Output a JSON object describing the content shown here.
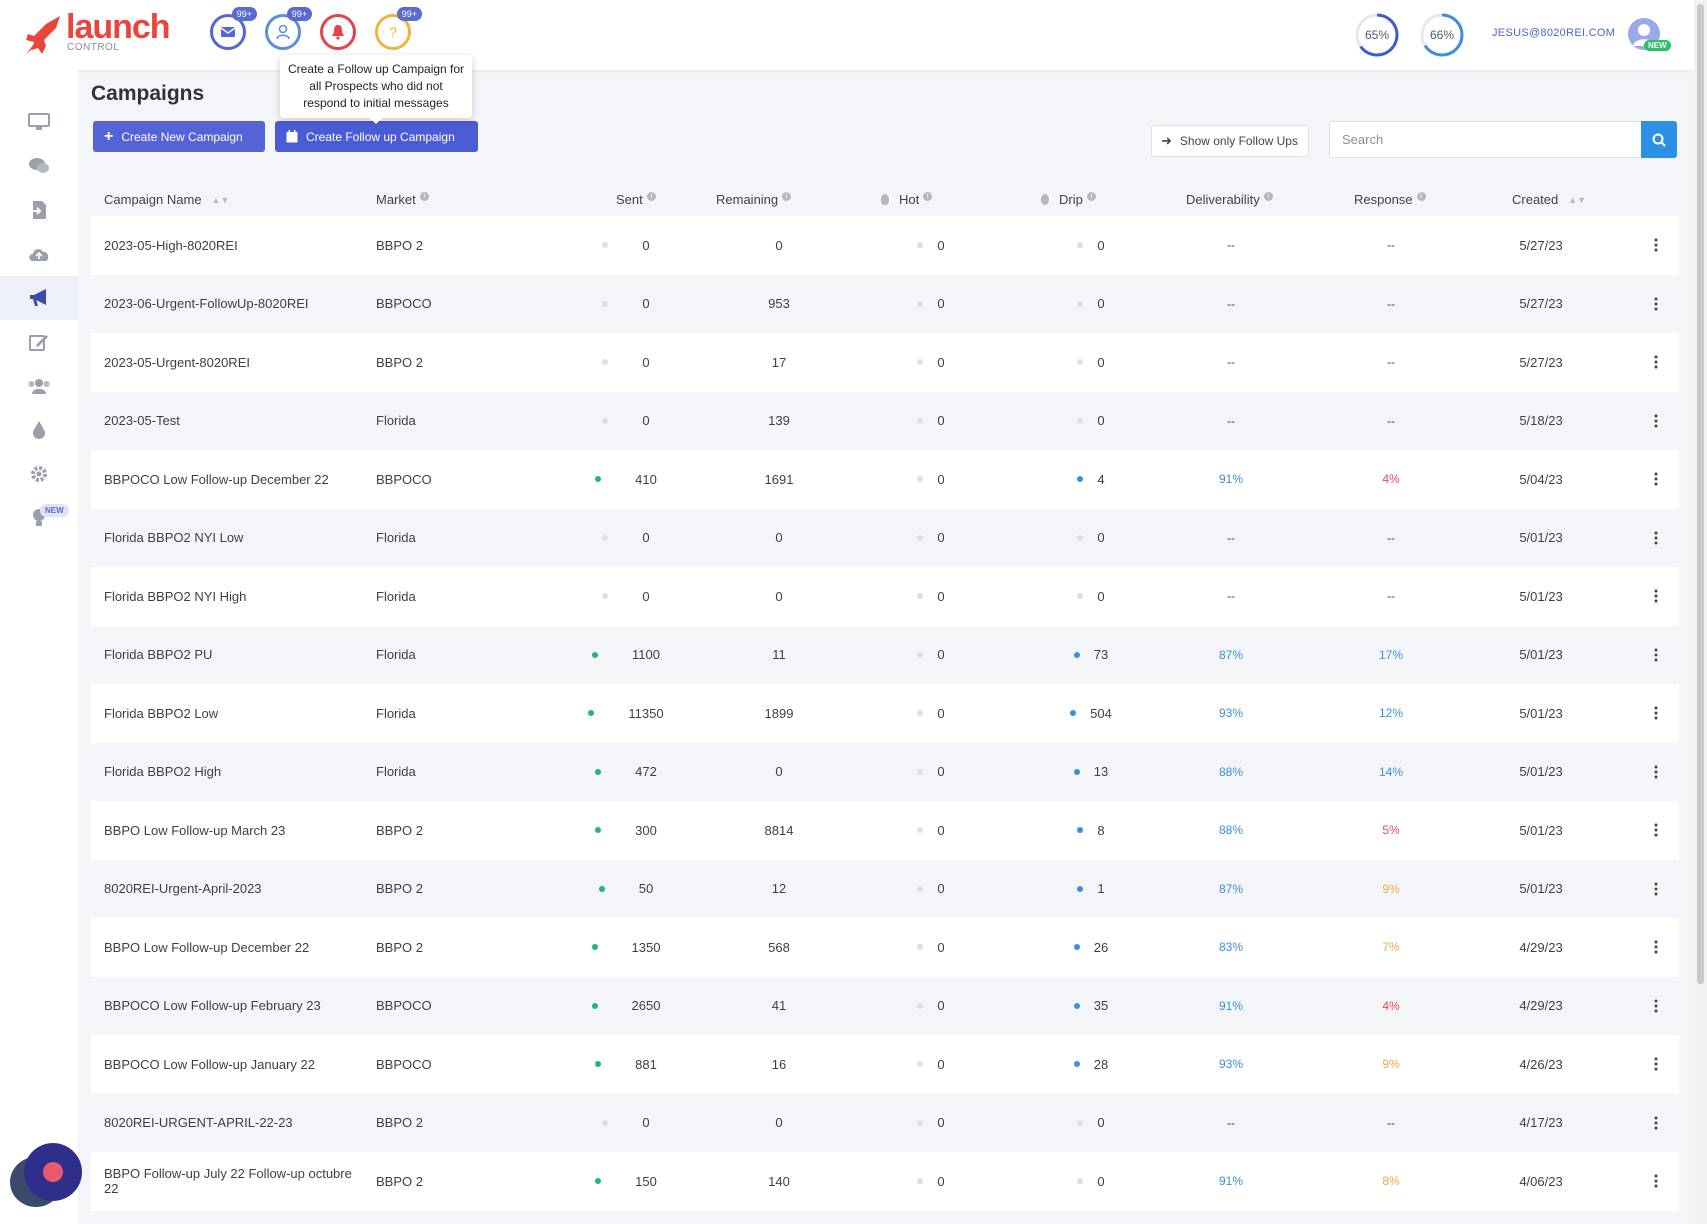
{
  "logo": {
    "text": "launch",
    "subtext": "CONTROL"
  },
  "header": {
    "notifications": [
      {
        "name": "mail-icon",
        "badge": "99+",
        "color": "#5468d4"
      },
      {
        "name": "user-icon",
        "badge": "99+",
        "color": "#5b8fd9"
      },
      {
        "name": "bell-icon",
        "badge": "",
        "color": "#e0454a"
      },
      {
        "name": "question-icon",
        "badge": "99+",
        "color": "#f0b43c"
      }
    ],
    "rings": [
      {
        "label": "65%",
        "value": 0.65
      },
      {
        "label": "66%",
        "value": 0.66
      }
    ],
    "user_email": "JESUS@8020REI.COM",
    "avatar_badge": "NEW"
  },
  "sidebar": {
    "items": [
      {
        "name": "monitor-icon"
      },
      {
        "name": "chat-icon"
      },
      {
        "name": "import-icon"
      },
      {
        "name": "cloud-upload-icon"
      },
      {
        "name": "megaphone-icon",
        "active": true
      },
      {
        "name": "edit-icon"
      },
      {
        "name": "users-icon"
      },
      {
        "name": "drip-icon"
      },
      {
        "name": "gear-icon"
      },
      {
        "name": "lightbulb-icon"
      }
    ],
    "new_badge": "NEW"
  },
  "page": {
    "title": "Campaigns",
    "create_new_label": "Create New Campaign",
    "create_follow_label": "Create Follow up Campaign",
    "tooltip": "Create a Follow up Campaign for all Prospects who did not respond to initial messages",
    "show_follow_label": "Show only Follow Ups",
    "search_placeholder": "Search"
  },
  "table": {
    "headers": {
      "name": "Campaign Name",
      "market": "Market",
      "sent": "Sent",
      "remaining": "Remaining",
      "hot": "Hot",
      "drip": "Drip",
      "deliverability": "Deliverability",
      "response": "Response",
      "created": "Created"
    },
    "colors": {
      "green": "#22b573",
      "blue": "#3b8fe0",
      "red": "#e84a55",
      "orange": "#f0a540",
      "grey": "#dcdfe4"
    },
    "rows": [
      {
        "name": "2023-05-High-8020REI",
        "market": "BBPO 2",
        "sent": "0",
        "remaining": "0",
        "hot": "0",
        "drip": "0",
        "deliv": "--",
        "resp": "--",
        "created": "5/27/23",
        "sent_on": false,
        "drip_on": false,
        "resp_color": ""
      },
      {
        "name": "2023-06-Urgent-FollowUp-8020REI",
        "market": "BBPOCO",
        "sent": "0",
        "remaining": "953",
        "hot": "0",
        "drip": "0",
        "deliv": "--",
        "resp": "--",
        "created": "5/27/23",
        "sent_on": false,
        "drip_on": false,
        "resp_color": ""
      },
      {
        "name": "2023-05-Urgent-8020REI",
        "market": "BBPO 2",
        "sent": "0",
        "remaining": "17",
        "hot": "0",
        "drip": "0",
        "deliv": "--",
        "resp": "--",
        "created": "5/27/23",
        "sent_on": false,
        "drip_on": false,
        "resp_color": ""
      },
      {
        "name": "2023-05-Test",
        "market": "Florida",
        "sent": "0",
        "remaining": "139",
        "hot": "0",
        "drip": "0",
        "deliv": "--",
        "resp": "--",
        "created": "5/18/23",
        "sent_on": false,
        "drip_on": false,
        "resp_color": ""
      },
      {
        "name": "BBPOCO Low Follow-up December 22",
        "market": "BBPOCO",
        "sent": "410",
        "remaining": "1691",
        "hot": "0",
        "drip": "4",
        "deliv": "91%",
        "resp": "4%",
        "created": "5/04/23",
        "sent_on": true,
        "drip_on": true,
        "resp_color": "red"
      },
      {
        "name": "Florida BBPO2 NYI Low",
        "market": "Florida",
        "sent": "0",
        "remaining": "0",
        "hot": "0",
        "drip": "0",
        "deliv": "--",
        "resp": "--",
        "created": "5/01/23",
        "sent_on": false,
        "drip_on": false,
        "resp_color": ""
      },
      {
        "name": "Florida BBPO2 NYI High",
        "market": "Florida",
        "sent": "0",
        "remaining": "0",
        "hot": "0",
        "drip": "0",
        "deliv": "--",
        "resp": "--",
        "created": "5/01/23",
        "sent_on": false,
        "drip_on": false,
        "resp_color": ""
      },
      {
        "name": "Florida BBPO2 PU",
        "market": "Florida",
        "sent": "1100",
        "remaining": "11",
        "hot": "0",
        "drip": "73",
        "deliv": "87%",
        "resp": "17%",
        "created": "5/01/23",
        "sent_on": true,
        "drip_on": true,
        "resp_color": "blue"
      },
      {
        "name": "Florida BBPO2 Low",
        "market": "Florida",
        "sent": "11350",
        "remaining": "1899",
        "hot": "0",
        "drip": "504",
        "deliv": "93%",
        "resp": "12%",
        "created": "5/01/23",
        "sent_on": true,
        "drip_on": true,
        "resp_color": "blue"
      },
      {
        "name": "Florida BBPO2 High",
        "market": "Florida",
        "sent": "472",
        "remaining": "0",
        "hot": "0",
        "drip": "13",
        "deliv": "88%",
        "resp": "14%",
        "created": "5/01/23",
        "sent_on": true,
        "drip_on": true,
        "resp_color": "blue"
      },
      {
        "name": "BBPO Low Follow-up March 23",
        "market": "BBPO 2",
        "sent": "300",
        "remaining": "8814",
        "hot": "0",
        "drip": "8",
        "deliv": "88%",
        "resp": "5%",
        "created": "5/01/23",
        "sent_on": true,
        "drip_on": true,
        "resp_color": "red"
      },
      {
        "name": "8020REI-Urgent-April-2023",
        "market": "BBPO 2",
        "sent": "50",
        "remaining": "12",
        "hot": "0",
        "drip": "1",
        "deliv": "87%",
        "resp": "9%",
        "created": "5/01/23",
        "sent_on": true,
        "drip_on": true,
        "resp_color": "orange"
      },
      {
        "name": "BBPO Low Follow-up December 22",
        "market": "BBPO 2",
        "sent": "1350",
        "remaining": "568",
        "hot": "0",
        "drip": "26",
        "deliv": "83%",
        "resp": "7%",
        "created": "4/29/23",
        "sent_on": true,
        "drip_on": true,
        "resp_color": "orange"
      },
      {
        "name": "BBPOCO Low Follow-up February 23",
        "market": "BBPOCO",
        "sent": "2650",
        "remaining": "41",
        "hot": "0",
        "drip": "35",
        "deliv": "91%",
        "resp": "4%",
        "created": "4/29/23",
        "sent_on": true,
        "drip_on": true,
        "resp_color": "red"
      },
      {
        "name": "BBPOCO Low Follow-up January 22",
        "market": "BBPOCO",
        "sent": "881",
        "remaining": "16",
        "hot": "0",
        "drip": "28",
        "deliv": "93%",
        "resp": "9%",
        "created": "4/26/23",
        "sent_on": true,
        "drip_on": true,
        "resp_color": "orange"
      },
      {
        "name": "8020REI-URGENT-APRIL-22-23",
        "market": "BBPO 2",
        "sent": "0",
        "remaining": "0",
        "hot": "0",
        "drip": "0",
        "deliv": "--",
        "resp": "--",
        "created": "4/17/23",
        "sent_on": false,
        "drip_on": false,
        "resp_color": ""
      },
      {
        "name": "BBPO Follow-up July 22 Follow-up octubre 22",
        "market": "BBPO 2",
        "sent": "150",
        "remaining": "140",
        "hot": "0",
        "drip": "0",
        "deliv": "91%",
        "resp": "8%",
        "created": "4/06/23",
        "sent_on": true,
        "drip_on": false,
        "resp_color": "orange"
      }
    ]
  }
}
